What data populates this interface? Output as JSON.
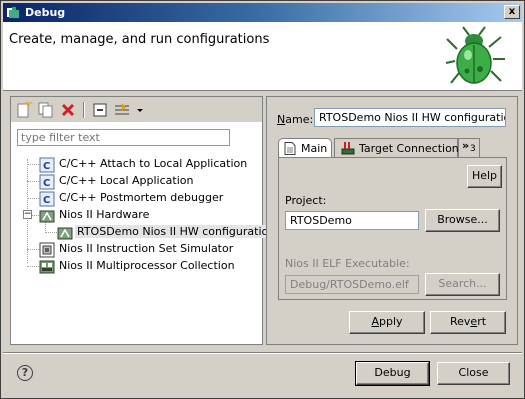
{
  "window": {
    "title": "Debug",
    "close_glyph": "x"
  },
  "header": {
    "title": "Create, manage, and run configurations"
  },
  "filter": {
    "placeholder": "type filter text"
  },
  "tree": {
    "items": [
      {
        "label": "C/C++ Attach to Local Application",
        "icon": "c-config-icon"
      },
      {
        "label": "C/C++ Local Application",
        "icon": "c-config-icon"
      },
      {
        "label": "C/C++ Postmortem debugger",
        "icon": "c-config-icon"
      },
      {
        "label": "Nios II Hardware",
        "icon": "nios-hw-icon",
        "expanded": true,
        "children": [
          {
            "label": "RTOSDemo Nios II HW configuration",
            "selected": true
          }
        ]
      },
      {
        "label": "Nios II Instruction Set Simulator",
        "icon": "nios-iss-icon"
      },
      {
        "label": "Nios II Multiprocessor Collection",
        "icon": "nios-multi-icon"
      }
    ]
  },
  "config": {
    "name_label_u": "N",
    "name_label_rest": "ame:",
    "name_value": "RTOSDemo Nios II HW configuration",
    "tabs": [
      {
        "label": "Main",
        "active": true
      },
      {
        "label": "Target Connection"
      },
      {
        "label": "3",
        "overflow_glyph": "»"
      }
    ],
    "help_button": "Help",
    "project_label": "Project:",
    "project_value": "RTOSDemo",
    "browse_button": "Browse...",
    "elf_label": "Nios II ELF Executable:",
    "elf_value": "Debug/RTOSDemo.elf",
    "search_button": "Search...",
    "apply_u": "A",
    "apply_rest": "pply",
    "revert_pre": "Rev",
    "revert_u": "e",
    "revert_rest": "rt"
  },
  "footer": {
    "help_glyph": "?",
    "debug_button": "Debug",
    "close_button": "Close"
  }
}
